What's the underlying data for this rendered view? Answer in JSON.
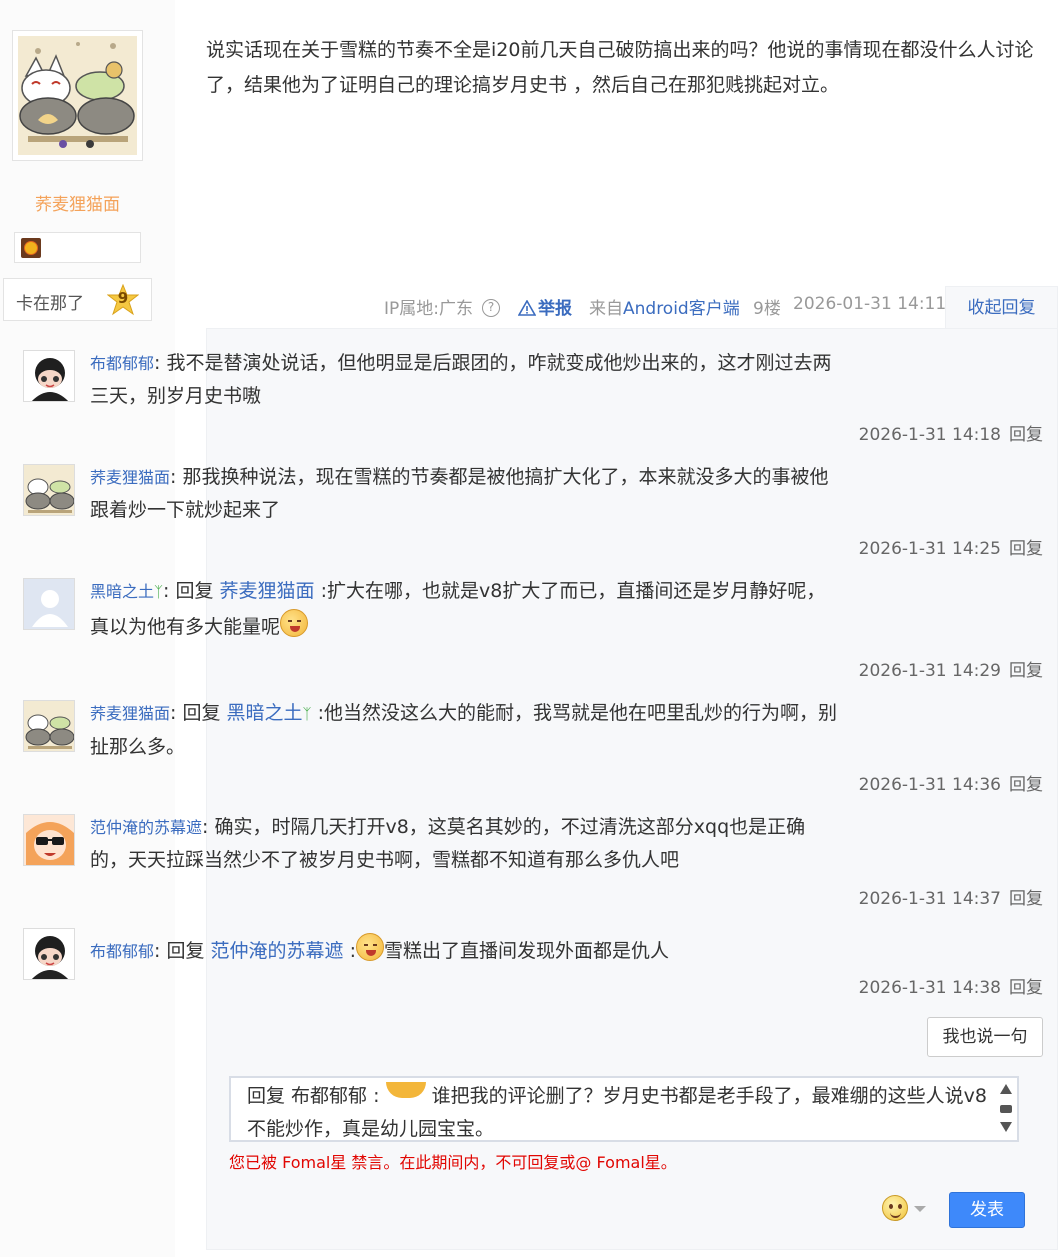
{
  "author": {
    "name": "荞麦狸猫面",
    "level_title": "卡在那了",
    "level": "9"
  },
  "post": {
    "text": "说实话现在关于雪糕的节奏不全是i20前几天自己破防搞出来的吗？他说的事情现在都没什么人讨论了，结果他为了证明自己的理论搞岁月史书 ，然后自己在那犯贱挑起对立。"
  },
  "tail": {
    "ip": "IP属地:广东",
    "help": "?",
    "report": "举报",
    "from_prefix": "来自",
    "client": "Android客户端",
    "floor": "9楼",
    "time": "2026-01-31 14:11",
    "collapse": "收起回复"
  },
  "comments": [
    {
      "user": "布都郁郁",
      "sep": ":",
      "text": " 我不是替演处说话，但他明显是后跟团的，咋就变成他炒出来的，这才刚过去两三天，别岁月史书嗷",
      "time": "2026-1-31 14:18",
      "reply": "回复"
    },
    {
      "user": "荞麦狸猫面",
      "sep": ":",
      "text": " 那我换种说法，现在雪糕的节奏都是被他搞扩大化了，本来就没多大的事被他跟着炒一下就炒起来了",
      "time": "2026-1-31 14:25",
      "reply": "回复"
    },
    {
      "user": "黑暗之土",
      "sep": ":",
      "reply_word": " 回复 ",
      "reply_to": "荞麦狸猫面",
      "text": " :扩大在哪，也就是v8扩大了而已，直播间还是岁月静好呢，真以为他有多大能量呢",
      "time": "2026-1-31 14:29",
      "reply": "回复"
    },
    {
      "user": "荞麦狸猫面",
      "sep": ":",
      "reply_word": " 回复 ",
      "reply_to": "黑暗之土",
      "text": " :他当然没这么大的能耐，我骂就是他在吧里乱炒的行为啊，别扯那么多。",
      "time": "2026-1-31 14:36",
      "reply": "回复"
    },
    {
      "user": "范仲淹的苏幕遮",
      "sep": ":",
      "text": " 确实，时隔几天打开v8，这莫名其妙的，不过清洗这部分xqq也是正确的，天天拉踩当然少不了被岁月史书啊，雪糕都不知道有那么多仇人吧",
      "time": "2026-1-31 14:37",
      "reply": "回复"
    },
    {
      "user": "布都郁郁",
      "sep": ":",
      "reply_word": " 回复 ",
      "reply_to": "范仲淹的苏幕遮",
      "text_pre": " :",
      "text": "雪糕出了直播间发现外面都是仇人",
      "time": "2026-1-31 14:38",
      "reply": "回复"
    }
  ],
  "say_button": "我也说一句",
  "editor": {
    "prefix": "回复 布都郁郁 :",
    "text": "谁把我的评论删了？岁月史书都是老手段了，最难绷的这些人说v8不能炒作，真是幼儿园宝宝。"
  },
  "ban_notice": "您已被 Fomal星 禁言。在此期间内，不可回复或@ Fomal星。",
  "submit": "发表",
  "colors": {
    "link": "#3b6cbf",
    "author_name": "#f4a259",
    "ban": "#e10602",
    "submit": "#3e89fa"
  }
}
